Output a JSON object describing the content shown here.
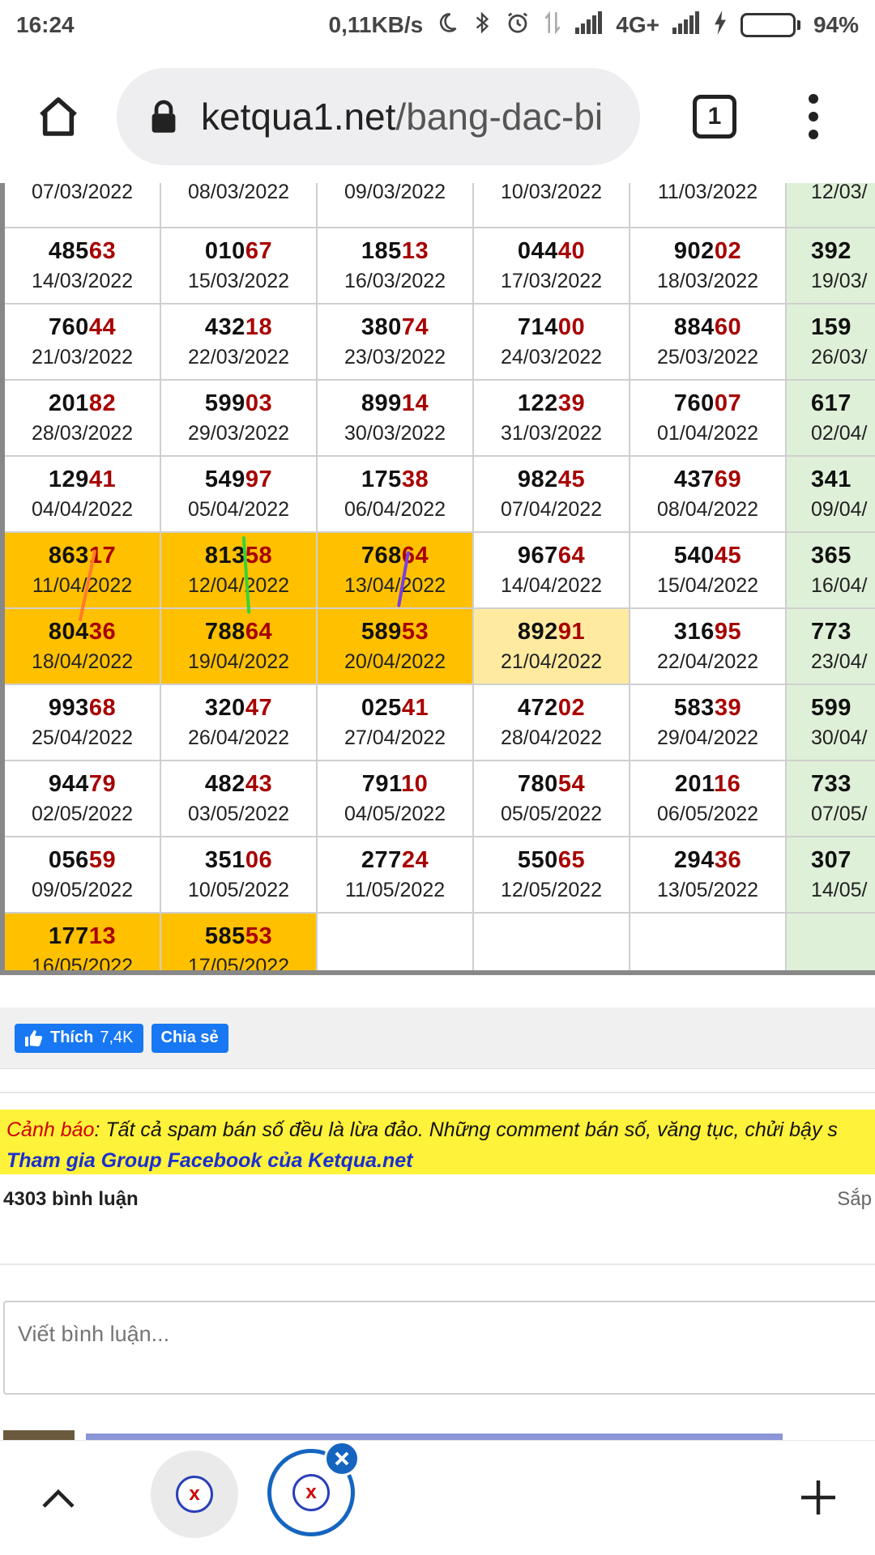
{
  "status_bar": {
    "time": "16:24",
    "network_speed": "0,11KB/s",
    "network_type": "4G+",
    "battery_percent": "94%",
    "battery_level": 0.94,
    "icons": [
      "moon-icon",
      "bluetooth-icon",
      "alarm-icon",
      "data-arrows-icon",
      "signal-icon",
      "signal-icon",
      "charging-icon",
      "battery-icon"
    ]
  },
  "browser": {
    "url_host": "ketqua1.net",
    "url_path": "/bang-dac-bi",
    "tab_count": "1"
  },
  "table": {
    "rows": [
      [
        {
          "num_head": "",
          "num_tail": "",
          "date": "07/03/2022"
        },
        {
          "num_head": "",
          "num_tail": "",
          "date": "08/03/2022"
        },
        {
          "num_head": "",
          "num_tail": "",
          "date": "09/03/2022"
        },
        {
          "num_head": "",
          "num_tail": "",
          "date": "10/03/2022"
        },
        {
          "num_head": "",
          "num_tail": "",
          "date": "11/03/2022"
        },
        {
          "num_head": "",
          "num_tail": "",
          "date": "12/03/"
        }
      ],
      [
        {
          "num_head": "485",
          "num_tail": "63",
          "date": "14/03/2022"
        },
        {
          "num_head": "010",
          "num_tail": "67",
          "date": "15/03/2022"
        },
        {
          "num_head": "185",
          "num_tail": "13",
          "date": "16/03/2022"
        },
        {
          "num_head": "044",
          "num_tail": "40",
          "date": "17/03/2022"
        },
        {
          "num_head": "902",
          "num_tail": "02",
          "date": "18/03/2022"
        },
        {
          "num_head": "392",
          "num_tail": "",
          "date": "19/03/"
        }
      ],
      [
        {
          "num_head": "760",
          "num_tail": "44",
          "date": "21/03/2022"
        },
        {
          "num_head": "432",
          "num_tail": "18",
          "date": "22/03/2022"
        },
        {
          "num_head": "380",
          "num_tail": "74",
          "date": "23/03/2022"
        },
        {
          "num_head": "714",
          "num_tail": "00",
          "date": "24/03/2022"
        },
        {
          "num_head": "884",
          "num_tail": "60",
          "date": "25/03/2022"
        },
        {
          "num_head": "159",
          "num_tail": "",
          "date": "26/03/"
        }
      ],
      [
        {
          "num_head": "201",
          "num_tail": "82",
          "date": "28/03/2022"
        },
        {
          "num_head": "599",
          "num_tail": "03",
          "date": "29/03/2022"
        },
        {
          "num_head": "899",
          "num_tail": "14",
          "date": "30/03/2022"
        },
        {
          "num_head": "122",
          "num_tail": "39",
          "date": "31/03/2022"
        },
        {
          "num_head": "760",
          "num_tail": "07",
          "date": "01/04/2022"
        },
        {
          "num_head": "617",
          "num_tail": "",
          "date": "02/04/"
        }
      ],
      [
        {
          "num_head": "129",
          "num_tail": "41",
          "date": "04/04/2022"
        },
        {
          "num_head": "549",
          "num_tail": "97",
          "date": "05/04/2022"
        },
        {
          "num_head": "175",
          "num_tail": "38",
          "date": "06/04/2022"
        },
        {
          "num_head": "982",
          "num_tail": "45",
          "date": "07/04/2022"
        },
        {
          "num_head": "437",
          "num_tail": "69",
          "date": "08/04/2022"
        },
        {
          "num_head": "341",
          "num_tail": "",
          "date": "09/04/"
        }
      ],
      [
        {
          "num_head": "863",
          "num_tail": "17",
          "date": "11/04/2022",
          "hl": "orange"
        },
        {
          "num_head": "813",
          "num_tail": "58",
          "date": "12/04/2022",
          "hl": "orange"
        },
        {
          "num_head": "768",
          "num_tail": "64",
          "date": "13/04/2022",
          "hl": "orange"
        },
        {
          "num_head": "967",
          "num_tail": "64",
          "date": "14/04/2022"
        },
        {
          "num_head": "540",
          "num_tail": "45",
          "date": "15/04/2022"
        },
        {
          "num_head": "365",
          "num_tail": "",
          "date": "16/04/"
        }
      ],
      [
        {
          "num_head": "804",
          "num_tail": "36",
          "date": "18/04/2022",
          "hl": "orange"
        },
        {
          "num_head": "788",
          "num_tail": "64",
          "date": "19/04/2022",
          "hl": "orange"
        },
        {
          "num_head": "589",
          "num_tail": "53",
          "date": "20/04/2022",
          "hl": "orange"
        },
        {
          "num_head": "892",
          "num_tail": "91",
          "date": "21/04/2022",
          "hl": "lightyellow"
        },
        {
          "num_head": "316",
          "num_tail": "95",
          "date": "22/04/2022"
        },
        {
          "num_head": "773",
          "num_tail": "",
          "date": "23/04/"
        }
      ],
      [
        {
          "num_head": "993",
          "num_tail": "68",
          "date": "25/04/2022"
        },
        {
          "num_head": "320",
          "num_tail": "47",
          "date": "26/04/2022"
        },
        {
          "num_head": "025",
          "num_tail": "41",
          "date": "27/04/2022"
        },
        {
          "num_head": "472",
          "num_tail": "02",
          "date": "28/04/2022"
        },
        {
          "num_head": "583",
          "num_tail": "39",
          "date": "29/04/2022"
        },
        {
          "num_head": "599",
          "num_tail": "",
          "date": "30/04/"
        }
      ],
      [
        {
          "num_head": "944",
          "num_tail": "79",
          "date": "02/05/2022"
        },
        {
          "num_head": "482",
          "num_tail": "43",
          "date": "03/05/2022"
        },
        {
          "num_head": "791",
          "num_tail": "10",
          "date": "04/05/2022"
        },
        {
          "num_head": "780",
          "num_tail": "54",
          "date": "05/05/2022"
        },
        {
          "num_head": "201",
          "num_tail": "16",
          "date": "06/05/2022"
        },
        {
          "num_head": "733",
          "num_tail": "",
          "date": "07/05/"
        }
      ],
      [
        {
          "num_head": "056",
          "num_tail": "59",
          "date": "09/05/2022"
        },
        {
          "num_head": "351",
          "num_tail": "06",
          "date": "10/05/2022"
        },
        {
          "num_head": "277",
          "num_tail": "24",
          "date": "11/05/2022"
        },
        {
          "num_head": "550",
          "num_tail": "65",
          "date": "12/05/2022"
        },
        {
          "num_head": "294",
          "num_tail": "36",
          "date": "13/05/2022"
        },
        {
          "num_head": "307",
          "num_tail": "",
          "date": "14/05/"
        }
      ],
      [
        {
          "num_head": "177",
          "num_tail": "13",
          "date": "16/05/2022",
          "hl": "orange"
        },
        {
          "num_head": "585",
          "num_tail": "53",
          "date": "17/05/2022",
          "hl": "orange"
        },
        {
          "num_head": "",
          "num_tail": "",
          "date": ""
        },
        {
          "num_head": "",
          "num_tail": "",
          "date": ""
        },
        {
          "num_head": "",
          "num_tail": "",
          "date": ""
        },
        {
          "num_head": "",
          "num_tail": "",
          "date": ""
        }
      ]
    ]
  },
  "social": {
    "like_label": "Thích",
    "like_count": "7,4K",
    "share_label": "Chia sẻ"
  },
  "warning": {
    "label": "Cảnh báo",
    "text": ": Tất cả spam bán số đều là lừa đảo. Những comment bán số, văng tục, chửi bậy s",
    "group_link": "Tham gia Group Facebook của Ketqua.net"
  },
  "comments": {
    "count": "4303 bình luận",
    "sort_label": "Sắp",
    "input_placeholder": "Viết bình luận..."
  },
  "colors": {
    "highlight_orange": "#ffc000",
    "highlight_light": "#ffeaa0",
    "column_green": "#dff0d8",
    "tail_red": "#a80000",
    "facebook_blue": "#1877f2",
    "warning_yellow": "#fff23a",
    "link_blue": "#1a2fd0",
    "tab_active_blue": "#1565c0"
  }
}
